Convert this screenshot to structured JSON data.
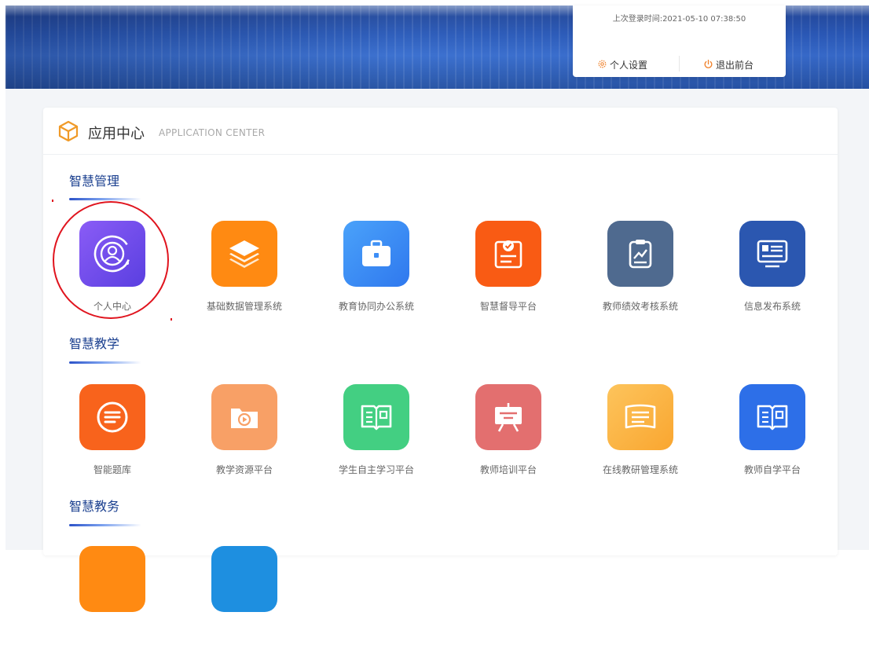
{
  "header": {
    "last_login": "上次登录时间:2021-05-10 07:38:50",
    "settings_label": "个人设置",
    "logout_label": "退出前台"
  },
  "app_center": {
    "title": "应用中心",
    "subtitle": "APPLICATION CENTER",
    "sections": [
      {
        "title": "智慧管理",
        "apps": [
          {
            "label": "个人中心",
            "icon": "user-profile-icon",
            "color": "#7b4ef2"
          },
          {
            "label": "基础数据管理系统",
            "icon": "layers-icon",
            "color": "#ff8a12"
          },
          {
            "label": "教育协同办公系统",
            "icon": "briefcase-icon",
            "color": "#3d8ef7"
          },
          {
            "label": "智慧督导平台",
            "icon": "checkmark-card-icon",
            "color": "#f95b14"
          },
          {
            "label": "教师绩效考核系统",
            "icon": "clipboard-chart-icon",
            "color": "#4f6a8f"
          },
          {
            "label": "信息发布系统",
            "icon": "monitor-icon",
            "color": "#2b57b0"
          }
        ]
      },
      {
        "title": "智慧教学",
        "apps": [
          {
            "label": "智能题库",
            "icon": "list-circle-icon",
            "color": "#f8631c"
          },
          {
            "label": "教学资源平台",
            "icon": "video-folder-icon",
            "color": "#f8a066"
          },
          {
            "label": "学生自主学习平台",
            "icon": "open-book-icon",
            "color": "#43cf82"
          },
          {
            "label": "教师培训平台",
            "icon": "presentation-board-icon",
            "color": "#e36f6f"
          },
          {
            "label": "在线教研管理系统",
            "icon": "document-card-icon",
            "color": "#fdb84c"
          },
          {
            "label": "教师自学平台",
            "icon": "open-book-icon",
            "color": "#2d6fe8"
          }
        ]
      },
      {
        "title": "智慧教务",
        "apps": [
          {
            "label": "",
            "icon": "app-icon",
            "color": "#ff8a12"
          },
          {
            "label": "",
            "icon": "app-icon",
            "color": "#1e8fe0"
          }
        ]
      }
    ]
  }
}
